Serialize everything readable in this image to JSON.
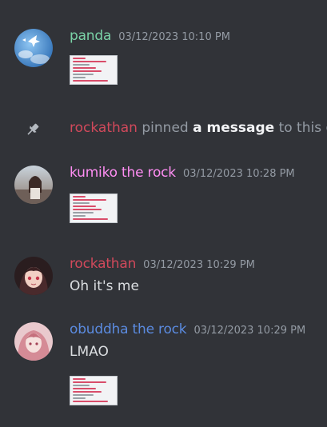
{
  "messages": [
    {
      "author": "panda",
      "author_color": "#7ad3a7",
      "timestamp": "03/12/2023 10:10 PM",
      "text": "",
      "attachment": "image"
    },
    {
      "author": "kumiko the rock",
      "author_color": "#ff8ef3",
      "timestamp": "03/12/2023 10:28 PM",
      "text": "",
      "attachment": "image"
    },
    {
      "author": "rockathan",
      "author_color": "#d1495b",
      "timestamp": "03/12/2023 10:29 PM",
      "text": "Oh it's me"
    },
    {
      "author": "obuddha the rock",
      "author_color": "#5b8be0",
      "timestamp": "03/12/2023 10:29 PM",
      "text": "LMAO",
      "attachment": "image"
    }
  ],
  "pin_notice": {
    "user": "rockathan",
    "text_before": "pinned",
    "link_text": "a message",
    "text_after": "to this ch",
    "icon": "pin-icon"
  }
}
